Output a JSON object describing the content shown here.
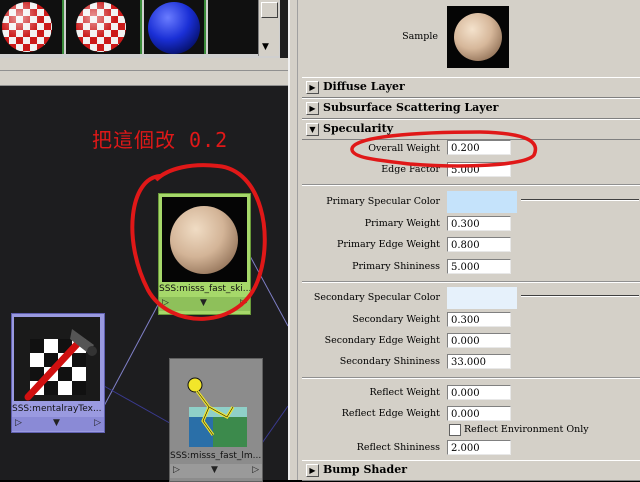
{
  "annotation": {
    "note": "把這個改 0.2"
  },
  "nodes": [
    {
      "label": "SSS:misss_fast_ski..."
    },
    {
      "label": "SSS:mentalrayTex..."
    },
    {
      "label": "SSS:misss_fast_lm..."
    }
  ],
  "sample": {
    "label": "Sample"
  },
  "sections": {
    "diffuse": "Diffuse Layer",
    "subsurface": "Subsurface Scattering Layer",
    "specularity": "Specularity",
    "bump": "Bump Shader"
  },
  "specularity": {
    "overall_weight": {
      "label": "Overall Weight",
      "value": "0.200"
    },
    "edge_factor": {
      "label": "Edge Factor",
      "value": "5.000"
    },
    "primary_color": {
      "label": "Primary Specular Color",
      "color": "#c5e3fb"
    },
    "primary_weight": {
      "label": "Primary Weight",
      "value": "0.300"
    },
    "primary_edge_weight": {
      "label": "Primary Edge Weight",
      "value": "0.800"
    },
    "primary_shininess": {
      "label": "Primary Shininess",
      "value": "5.000"
    },
    "secondary_color": {
      "label": "Secondary Specular Color",
      "color": "#e6f1fb"
    },
    "secondary_weight": {
      "label": "Secondary Weight",
      "value": "0.300"
    },
    "secondary_edge_weight": {
      "label": "Secondary Edge Weight",
      "value": "0.000"
    },
    "secondary_shininess": {
      "label": "Secondary Shininess",
      "value": "33.000"
    },
    "reflect_weight": {
      "label": "Reflect Weight",
      "value": "0.000"
    },
    "reflect_edge_weight": {
      "label": "Reflect Edge Weight",
      "value": "0.000"
    },
    "reflect_env_only": {
      "label": "Reflect Environment Only",
      "checked": false
    },
    "reflect_shininess": {
      "label": "Reflect Shininess",
      "value": "2.000"
    }
  },
  "colors": {
    "annotation_red": "#e01818",
    "node_selected": "#a6d86a",
    "node_purple": "#9a9ae0"
  }
}
